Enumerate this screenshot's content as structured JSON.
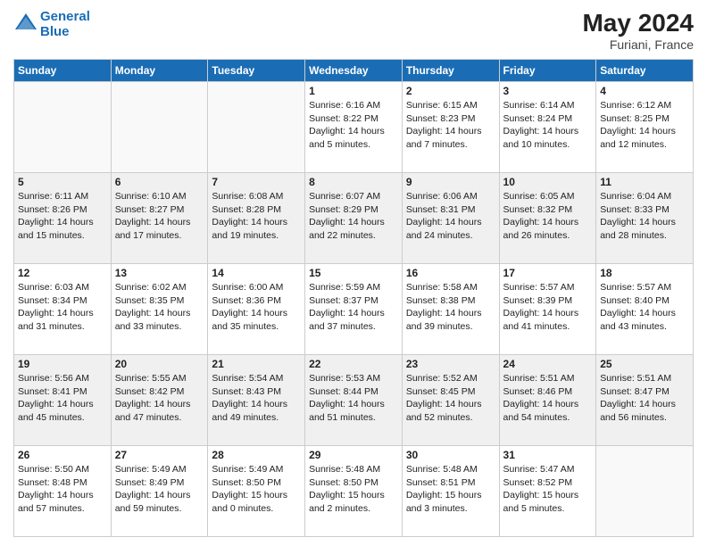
{
  "header": {
    "logo_line1": "General",
    "logo_line2": "Blue",
    "month_year": "May 2024",
    "location": "Furiani, France"
  },
  "days_of_week": [
    "Sunday",
    "Monday",
    "Tuesday",
    "Wednesday",
    "Thursday",
    "Friday",
    "Saturday"
  ],
  "weeks": [
    [
      {
        "day": "",
        "text": ""
      },
      {
        "day": "",
        "text": ""
      },
      {
        "day": "",
        "text": ""
      },
      {
        "day": "1",
        "text": "Sunrise: 6:16 AM\nSunset: 8:22 PM\nDaylight: 14 hours\nand 5 minutes."
      },
      {
        "day": "2",
        "text": "Sunrise: 6:15 AM\nSunset: 8:23 PM\nDaylight: 14 hours\nand 7 minutes."
      },
      {
        "day": "3",
        "text": "Sunrise: 6:14 AM\nSunset: 8:24 PM\nDaylight: 14 hours\nand 10 minutes."
      },
      {
        "day": "4",
        "text": "Sunrise: 6:12 AM\nSunset: 8:25 PM\nDaylight: 14 hours\nand 12 minutes."
      }
    ],
    [
      {
        "day": "5",
        "text": "Sunrise: 6:11 AM\nSunset: 8:26 PM\nDaylight: 14 hours\nand 15 minutes."
      },
      {
        "day": "6",
        "text": "Sunrise: 6:10 AM\nSunset: 8:27 PM\nDaylight: 14 hours\nand 17 minutes."
      },
      {
        "day": "7",
        "text": "Sunrise: 6:08 AM\nSunset: 8:28 PM\nDaylight: 14 hours\nand 19 minutes."
      },
      {
        "day": "8",
        "text": "Sunrise: 6:07 AM\nSunset: 8:29 PM\nDaylight: 14 hours\nand 22 minutes."
      },
      {
        "day": "9",
        "text": "Sunrise: 6:06 AM\nSunset: 8:31 PM\nDaylight: 14 hours\nand 24 minutes."
      },
      {
        "day": "10",
        "text": "Sunrise: 6:05 AM\nSunset: 8:32 PM\nDaylight: 14 hours\nand 26 minutes."
      },
      {
        "day": "11",
        "text": "Sunrise: 6:04 AM\nSunset: 8:33 PM\nDaylight: 14 hours\nand 28 minutes."
      }
    ],
    [
      {
        "day": "12",
        "text": "Sunrise: 6:03 AM\nSunset: 8:34 PM\nDaylight: 14 hours\nand 31 minutes."
      },
      {
        "day": "13",
        "text": "Sunrise: 6:02 AM\nSunset: 8:35 PM\nDaylight: 14 hours\nand 33 minutes."
      },
      {
        "day": "14",
        "text": "Sunrise: 6:00 AM\nSunset: 8:36 PM\nDaylight: 14 hours\nand 35 minutes."
      },
      {
        "day": "15",
        "text": "Sunrise: 5:59 AM\nSunset: 8:37 PM\nDaylight: 14 hours\nand 37 minutes."
      },
      {
        "day": "16",
        "text": "Sunrise: 5:58 AM\nSunset: 8:38 PM\nDaylight: 14 hours\nand 39 minutes."
      },
      {
        "day": "17",
        "text": "Sunrise: 5:57 AM\nSunset: 8:39 PM\nDaylight: 14 hours\nand 41 minutes."
      },
      {
        "day": "18",
        "text": "Sunrise: 5:57 AM\nSunset: 8:40 PM\nDaylight: 14 hours\nand 43 minutes."
      }
    ],
    [
      {
        "day": "19",
        "text": "Sunrise: 5:56 AM\nSunset: 8:41 PM\nDaylight: 14 hours\nand 45 minutes."
      },
      {
        "day": "20",
        "text": "Sunrise: 5:55 AM\nSunset: 8:42 PM\nDaylight: 14 hours\nand 47 minutes."
      },
      {
        "day": "21",
        "text": "Sunrise: 5:54 AM\nSunset: 8:43 PM\nDaylight: 14 hours\nand 49 minutes."
      },
      {
        "day": "22",
        "text": "Sunrise: 5:53 AM\nSunset: 8:44 PM\nDaylight: 14 hours\nand 51 minutes."
      },
      {
        "day": "23",
        "text": "Sunrise: 5:52 AM\nSunset: 8:45 PM\nDaylight: 14 hours\nand 52 minutes."
      },
      {
        "day": "24",
        "text": "Sunrise: 5:51 AM\nSunset: 8:46 PM\nDaylight: 14 hours\nand 54 minutes."
      },
      {
        "day": "25",
        "text": "Sunrise: 5:51 AM\nSunset: 8:47 PM\nDaylight: 14 hours\nand 56 minutes."
      }
    ],
    [
      {
        "day": "26",
        "text": "Sunrise: 5:50 AM\nSunset: 8:48 PM\nDaylight: 14 hours\nand 57 minutes."
      },
      {
        "day": "27",
        "text": "Sunrise: 5:49 AM\nSunset: 8:49 PM\nDaylight: 14 hours\nand 59 minutes."
      },
      {
        "day": "28",
        "text": "Sunrise: 5:49 AM\nSunset: 8:50 PM\nDaylight: 15 hours\nand 0 minutes."
      },
      {
        "day": "29",
        "text": "Sunrise: 5:48 AM\nSunset: 8:50 PM\nDaylight: 15 hours\nand 2 minutes."
      },
      {
        "day": "30",
        "text": "Sunrise: 5:48 AM\nSunset: 8:51 PM\nDaylight: 15 hours\nand 3 minutes."
      },
      {
        "day": "31",
        "text": "Sunrise: 5:47 AM\nSunset: 8:52 PM\nDaylight: 15 hours\nand 5 minutes."
      },
      {
        "day": "",
        "text": ""
      }
    ]
  ]
}
